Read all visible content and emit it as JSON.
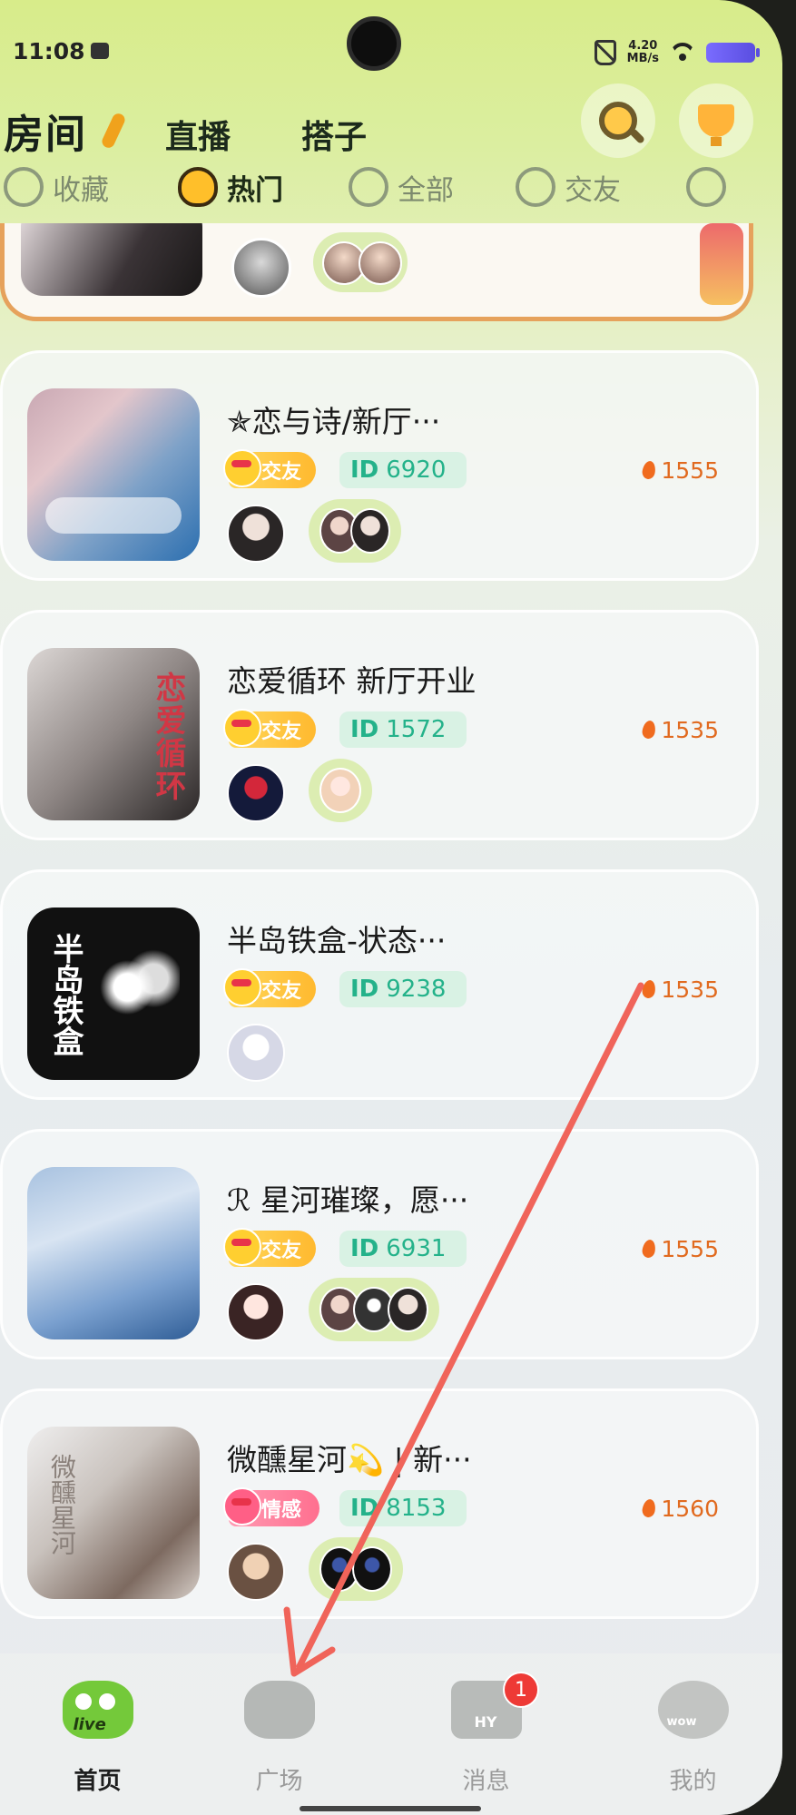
{
  "status_bar": {
    "time": "11:08",
    "net_speed_value": "4.20",
    "net_speed_unit": "MB/s"
  },
  "header": {
    "title": "房间",
    "tabs": [
      "直播",
      "搭子"
    ],
    "search_icon": "search-icon",
    "trophy_icon": "trophy-icon"
  },
  "categories": [
    {
      "label": "收藏",
      "icon": "heartbeat-icon"
    },
    {
      "label": "热门",
      "icon": "fire-face-icon",
      "active": true
    },
    {
      "label": "全部",
      "icon": "flower-face-icon"
    },
    {
      "label": "交友",
      "icon": "hand-icon"
    }
  ],
  "rooms": [
    {
      "name": "✯恋与诗/新厅···",
      "tag": "交友",
      "id_label": "ID",
      "id": "6920",
      "heat": "1555"
    },
    {
      "name": "恋爱循环 新厅开业",
      "tag": "交友",
      "id_label": "ID",
      "id": "1572",
      "heat": "1535",
      "cover_text": "恋爱循环"
    },
    {
      "name": "半岛铁盒-状态···",
      "tag": "交友",
      "id_label": "ID",
      "id": "9238",
      "heat": "1535",
      "cover_text": "半岛铁盒"
    },
    {
      "name": "ℛ 星河璀璨，愿···",
      "tag": "交友",
      "id_label": "ID",
      "id": "6931",
      "heat": "1555"
    },
    {
      "name": "微醺星河💫 | 新···",
      "tag": "情感",
      "id_label": "ID",
      "id": "8153",
      "heat": "1560",
      "cover_text": "微醺星河"
    }
  ],
  "bottom_nav": [
    {
      "label": "首页",
      "icon_text": "live",
      "active": true
    },
    {
      "label": "广场"
    },
    {
      "label": "消息",
      "icon_text": "HY",
      "badge": "1"
    },
    {
      "label": "我的",
      "icon_text": "wow"
    }
  ],
  "colors": {
    "accent_green": "#74c93a",
    "heat_orange": "#e16a1f",
    "id_green": "#24b28a",
    "annotation_arrow": "#f0645a"
  }
}
